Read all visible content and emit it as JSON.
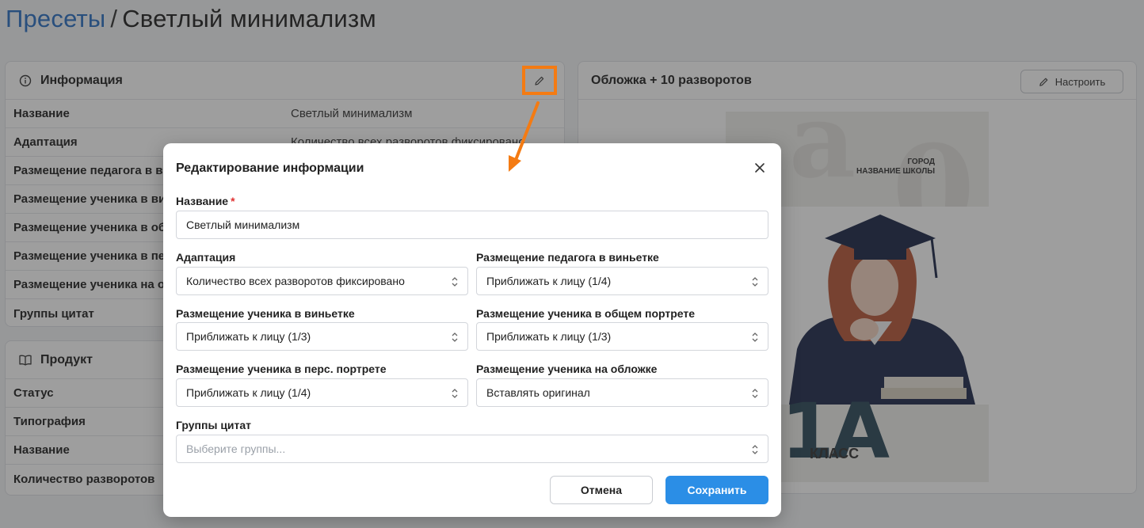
{
  "breadcrumb": {
    "parent": "Пресеты",
    "separator": "/",
    "current": "Светлый минимализм"
  },
  "info_card": {
    "title": "Информация",
    "rows": [
      {
        "label": "Название",
        "value": "Светлый минимализм"
      },
      {
        "label": "Адаптация",
        "value": "Количество всех разворотов фиксировано"
      },
      {
        "label": "Размещение педагога в виньетке",
        "value": ""
      },
      {
        "label": "Размещение ученика в виньетке",
        "value": ""
      },
      {
        "label": "Размещение ученика в общем портрете",
        "value": ""
      },
      {
        "label": "Размещение ученика в перс. портрете",
        "value": ""
      },
      {
        "label": "Размещение ученика на обложке",
        "value": ""
      },
      {
        "label": "Группы цитат",
        "value": ""
      }
    ]
  },
  "product_card": {
    "title": "Продукт",
    "rows": [
      {
        "label": "Статус"
      },
      {
        "label": "Типография"
      },
      {
        "label": "Название"
      },
      {
        "label": "Количество разворотов"
      }
    ]
  },
  "cover_card": {
    "title": "Обложка + 10 разворотов",
    "configure_label": "Настроить",
    "cover": {
      "city_line1": "ГОРОД",
      "city_line2": "НАЗВАНИЕ ШКОЛЫ",
      "grade": "1А",
      "klass": "КЛАСС"
    }
  },
  "modal": {
    "title": "Редактирование информации",
    "name_label": "Название",
    "required_mark": "*",
    "name_value": "Светлый минимализм",
    "adaptation_label": "Адаптация",
    "adaptation_value": "Количество всех разворотов фиксировано",
    "teacher_vignette_label": "Размещение педагога в виньетке",
    "teacher_vignette_value": "Приближать к лицу (1/4)",
    "student_vignette_label": "Размещение ученика в виньетке",
    "student_vignette_value": "Приближать к лицу (1/3)",
    "student_group_label": "Размещение ученика в общем портрете",
    "student_group_value": "Приближать к лицу (1/3)",
    "student_personal_label": "Размещение ученика в перс. портрете",
    "student_personal_value": "Приближать к лицу (1/4)",
    "student_cover_label": "Размещение ученика на обложке",
    "student_cover_value": "Вставлять оригинал",
    "quote_groups_label": "Группы цитат",
    "quote_groups_placeholder": "Выберите группы...",
    "cancel_label": "Отмена",
    "save_label": "Сохранить"
  },
  "colors": {
    "accent": "#2b8ee6",
    "link": "#2a6fc4",
    "highlight": "#f47b13",
    "required": "#e03131"
  },
  "icons": {
    "info": "info-circle-icon",
    "product": "book-icon",
    "edit": "pencil-icon",
    "close": "close-icon",
    "select": "chevron-updown-icon"
  }
}
